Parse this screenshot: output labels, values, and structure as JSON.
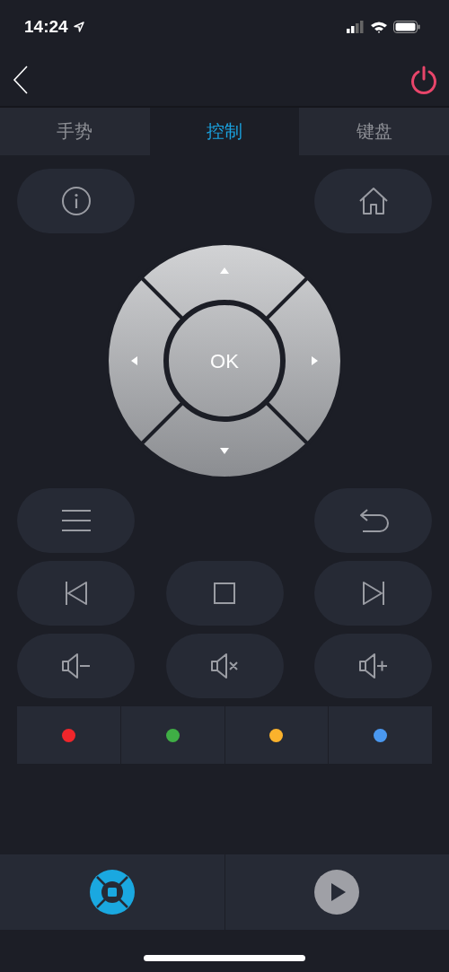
{
  "status_bar": {
    "time": "14:24"
  },
  "tabs": [
    {
      "label": "手势",
      "selected": false
    },
    {
      "label": "控制",
      "selected": true
    },
    {
      "label": "键盘",
      "selected": false
    }
  ],
  "top_buttons": {
    "left": {
      "kind": "info"
    },
    "right": {
      "kind": "home"
    }
  },
  "dpad": {
    "ok_label": "OK"
  },
  "button_rows": [
    {
      "left": {
        "kind": "menu"
      },
      "right": {
        "kind": "back"
      }
    },
    {
      "left": {
        "kind": "previous"
      },
      "center": {
        "kind": "stop"
      },
      "right": {
        "kind": "next"
      }
    },
    {
      "left": {
        "kind": "volume-down"
      },
      "center": {
        "kind": "mute"
      },
      "right": {
        "kind": "volume-up"
      }
    }
  ],
  "color_keys": [
    {
      "color": "#f0262b"
    },
    {
      "color": "#3fae45"
    },
    {
      "color": "#fbb22c"
    },
    {
      "color": "#4a98f0"
    }
  ],
  "bottom_tabs": [
    {
      "kind": "dpad",
      "selected": true
    },
    {
      "kind": "play",
      "selected": false
    }
  ]
}
